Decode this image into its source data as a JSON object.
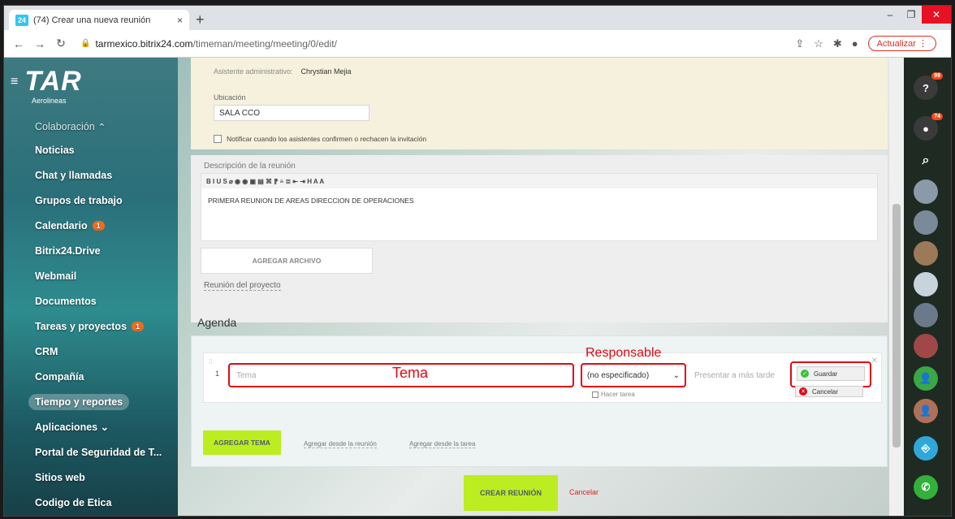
{
  "browser": {
    "tab_icon_text": "24",
    "tab_title": "(74) Crear una nueva reunión",
    "tab_close": "×",
    "new_tab": "+",
    "url_host": "tarmexico.bitrix24.com",
    "url_path": "/timeman/meeting/meeting/0/edit/",
    "update_button": "Actualizar"
  },
  "sidebar": {
    "logo": "TAR",
    "logo_sub": "Aerolineas",
    "section": "Colaboración",
    "items": [
      {
        "label": "Noticias"
      },
      {
        "label": "Chat y llamadas"
      },
      {
        "label": "Grupos de trabajo"
      },
      {
        "label": "Calendario",
        "badge": "1"
      },
      {
        "label": "Bitrix24.Drive"
      },
      {
        "label": "Webmail"
      },
      {
        "label": "Documentos"
      },
      {
        "label": "Tareas y proyectos",
        "badge": "1"
      },
      {
        "label": "CRM"
      },
      {
        "label": "Compañía"
      },
      {
        "label": "Tiempo y reportes"
      },
      {
        "label": "Aplicaciones"
      },
      {
        "label": "Portal de Seguridad de T..."
      },
      {
        "label": "Sitios web"
      },
      {
        "label": "Codigo de Etica"
      }
    ]
  },
  "meeting": {
    "asistente_label": "Asistente administrativo:",
    "asistente_value": "Chrystian Mejia",
    "ubicacion_label": "Ubicación",
    "ubicacion_value": "SALA CCO",
    "notificar_label": "Notificar cuando los asistentes confirmen o rechacen la invitación",
    "descripcion_label": "Descripción de la reunión",
    "descripcion_text": "PRIMERA REUNION DE AREAS DIRECCION DE OPERACIONES",
    "toolbar": "B I U S ⌀ ◉ ◉ ▣ ▤ ⌘ ⁋ ≡ ≣ ⇤ ⇥ H A A",
    "agregar_archivo": "AGREGAR ARCHIVO",
    "reunion_proyecto": "Reunión del proyecto"
  },
  "agenda": {
    "title": "Agenda",
    "row_number": "1",
    "tema_placeholder": "Tema",
    "tema_annotation": "Tema",
    "responsable_annotation": "Responsable",
    "responsable_value": "(no especificado)",
    "hacer_tarea": "Hacer tarea",
    "presentar_placeholder": "Presentar a más tarde",
    "guardar": "Guardar",
    "cancelar": "Cancelar",
    "agregar_tema": "AGREGAR TEMA",
    "agregar_reunion": "Agregar desde la reunión",
    "agregar_tarea": "Agregar desde la tarea"
  },
  "footer": {
    "crear": "CREAR REUNIÓN",
    "cancelar": "Cancelar"
  },
  "rightbar": {
    "help_count": "99",
    "notif_count": "74"
  }
}
